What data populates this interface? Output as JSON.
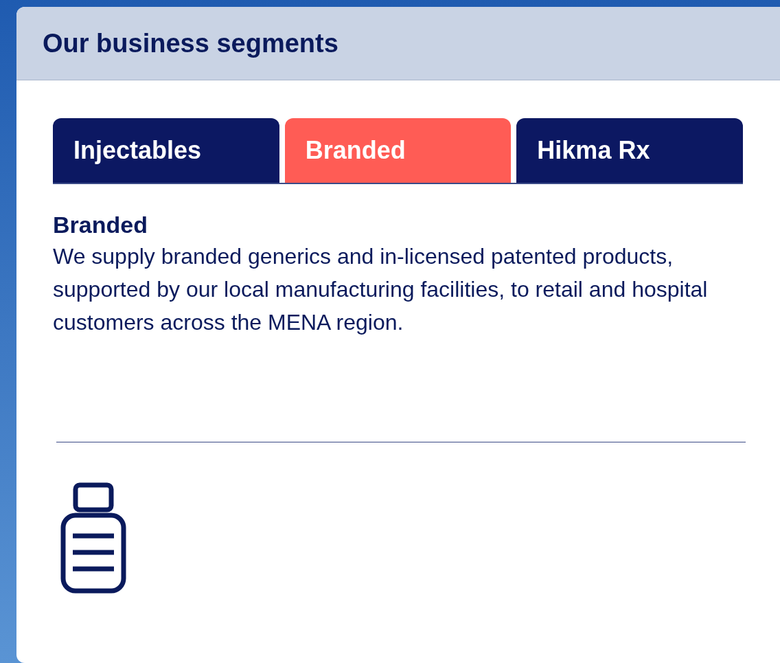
{
  "panel": {
    "title": "Our business segments"
  },
  "tabs": [
    {
      "label": "Injectables",
      "selected": false
    },
    {
      "label": "Branded",
      "selected": true
    },
    {
      "label": "Hikma Rx",
      "selected": false
    }
  ],
  "content": {
    "heading": "Branded",
    "text": "We supply branded generics and in-licensed patented products, supported by our local manufacturing facilities, to retail and hospital customers across the MENA region."
  }
}
